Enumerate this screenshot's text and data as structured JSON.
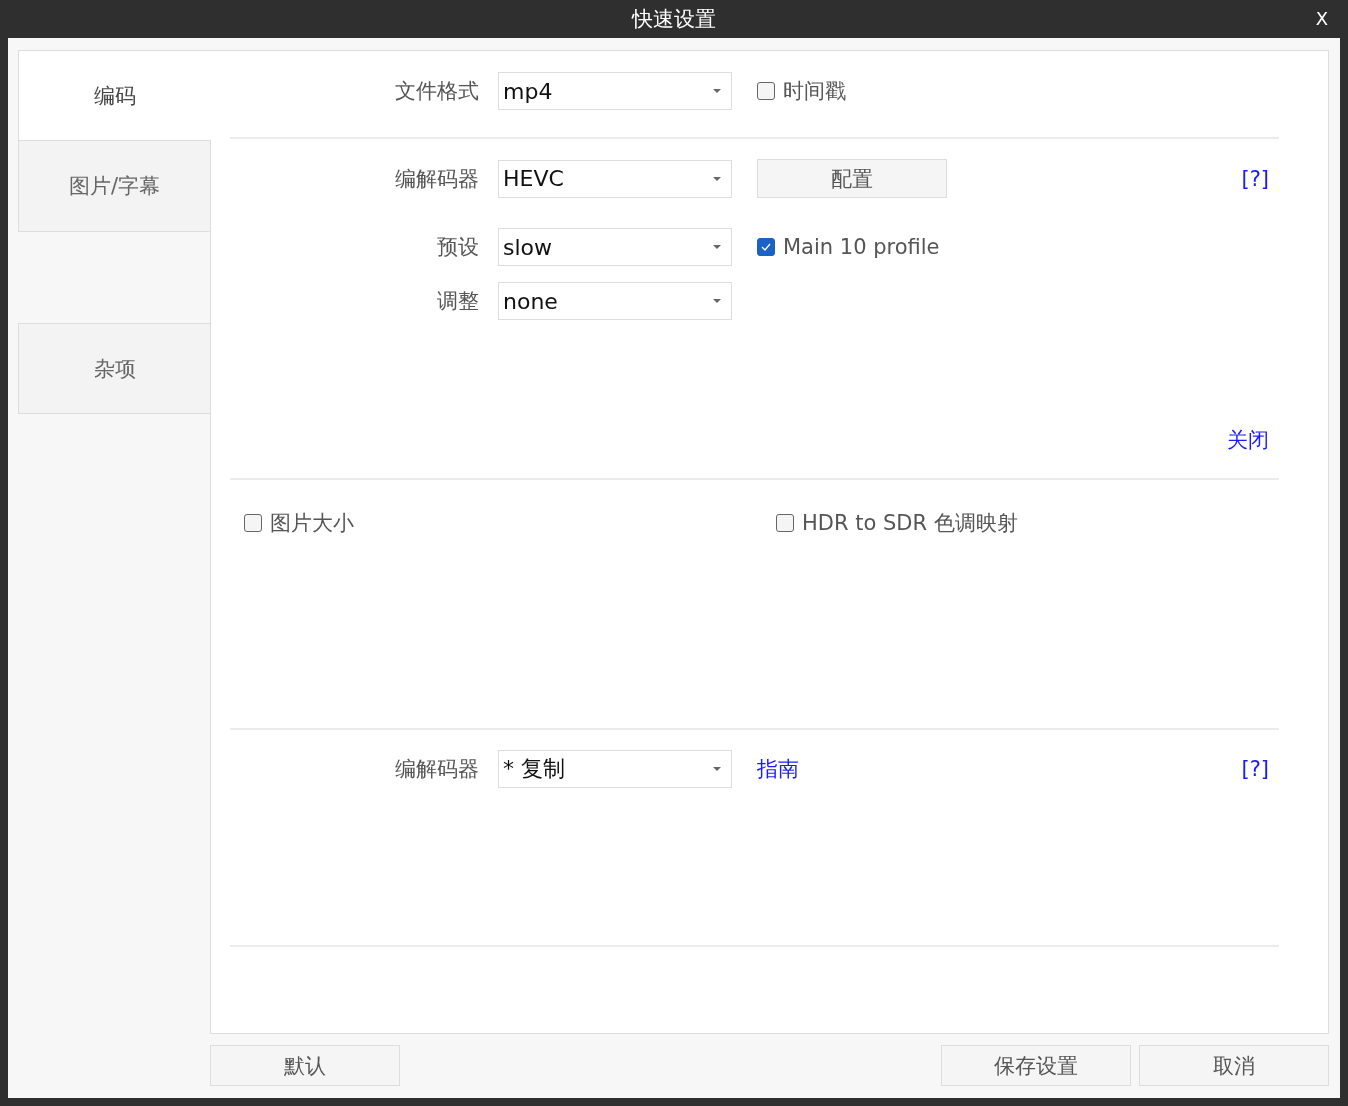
{
  "window": {
    "title": "快速设置",
    "close": "X"
  },
  "tabs": [
    {
      "label": "编码",
      "selected": true
    },
    {
      "label": "图片/字幕",
      "selected": false
    },
    {
      "label": "杂项",
      "selected": false
    }
  ],
  "format": {
    "label": "文件格式",
    "value": "mp4",
    "timestamp": {
      "label": "时间戳",
      "checked": false
    }
  },
  "video": {
    "codec": {
      "label": "编解码器",
      "value": "HEVC"
    },
    "config_button": "配置",
    "help": "[?]",
    "preset": {
      "label": "预设",
      "value": "slow"
    },
    "main10": {
      "label": "Main 10 profile",
      "checked": true
    },
    "tune": {
      "label": "调整",
      "value": "none"
    },
    "close_link": "关闭"
  },
  "picture": {
    "resize": {
      "label": "图片大小",
      "checked": false
    },
    "hdr": {
      "label": "HDR to SDR 色调映射",
      "checked": false
    }
  },
  "audio": {
    "codec": {
      "label": "编解码器",
      "value": "* 复制"
    },
    "guide_link": "指南",
    "help": "[?]"
  },
  "buttons": {
    "default": "默认",
    "save": "保存设置",
    "cancel": "取消"
  }
}
